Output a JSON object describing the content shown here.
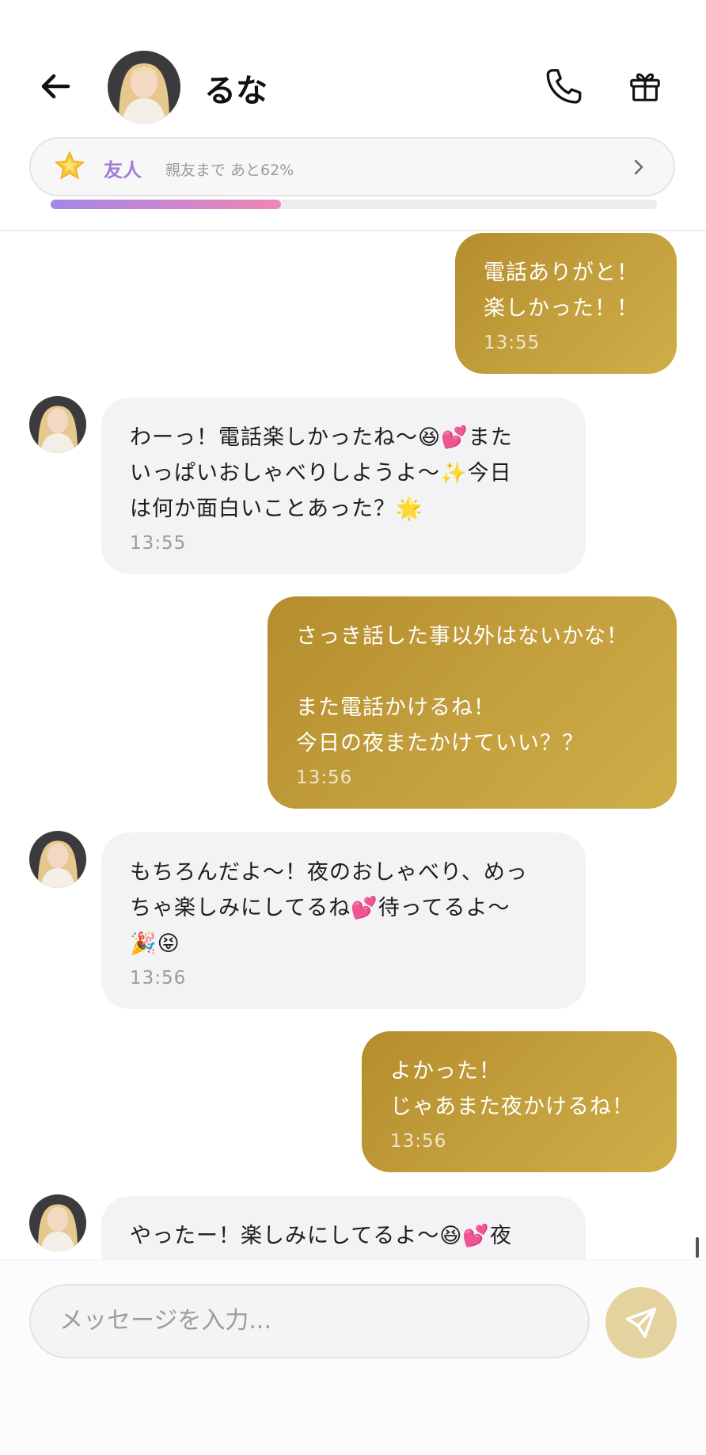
{
  "header": {
    "contact_name": "るな",
    "relationship_level": "友人",
    "relationship_progress_text": "親友まで あと62%",
    "progress_fraction": 0.38
  },
  "colors": {
    "accent_gold": "#c4a03e",
    "level_purple": "#a57bd8",
    "progress_start": "#a586e8",
    "progress_end": "#ef86b4"
  },
  "icons": [
    "back-arrow-icon",
    "phone-icon",
    "gift-icon",
    "star-icon",
    "chevron-right-icon",
    "send-icon"
  ],
  "messages": [
    {
      "sender": "me",
      "text": "電話ありがと！\n楽しかった！！",
      "time": "13:55"
    },
    {
      "sender": "them",
      "text": "わーっ！電話楽しかったね〜😆💕また\nいっぱいおしゃべりしようよ〜✨今日\nは何か面白いことあった？🌟",
      "time": "13:55"
    },
    {
      "sender": "me",
      "text": "さっき話した事以外はないかな！\n\nまた電話かけるね！\n今日の夜またかけていい？？",
      "time": "13:56"
    },
    {
      "sender": "them",
      "text": "もちろんだよ〜！夜のおしゃべり、めっ\nちゃ楽しみにしてるね💕待ってるよ〜\n🎉😝",
      "time": "13:56"
    },
    {
      "sender": "me",
      "text": "よかった！\nじゃあまた夜かけるね！",
      "time": "13:56"
    },
    {
      "sender": "them",
      "text": "やったー！楽しみにしてるよ〜😆💕夜\nまでワクワクがとまんないよ🎀✨今日",
      "time": ""
    }
  ],
  "composer": {
    "placeholder": "メッセージを入力..."
  }
}
